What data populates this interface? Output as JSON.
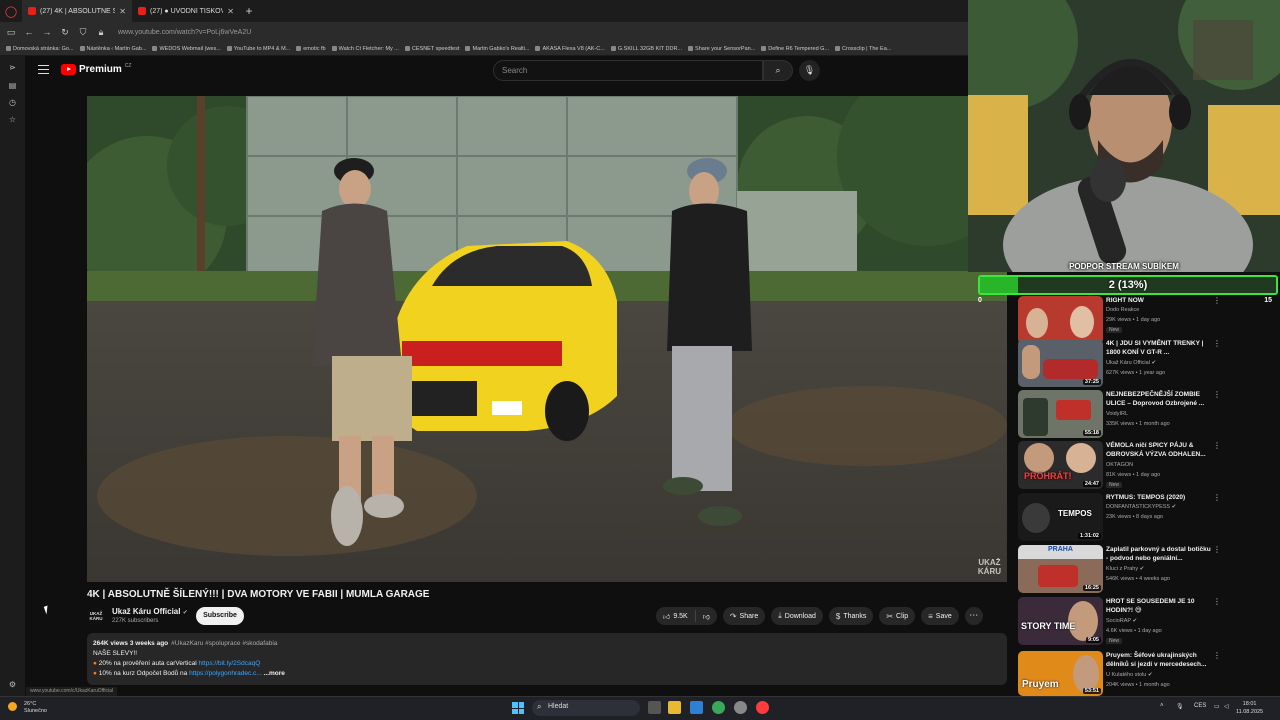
{
  "browser": {
    "tabs": [
      {
        "label": "(27) 4K | ABSOLUTNĚ ŠÍLENÝ!!! | DVA MOTORY",
        "active": true
      },
      {
        "label": "(27) ● ÚVODNÍ TISKOVÁ KONFERENCE",
        "active": false
      }
    ],
    "url": "www.youtube.com/watch?v=PoLj6wVeA2U",
    "bookmarks": [
      "Domovská stránka: Go...",
      "Nástěnka ‹ Martin Gab...",
      "WEDOS Webmail (wes...",
      "YouTube to MP4 & M...",
      "emotic fb",
      "Watch Ct Fletcher: My ...",
      "CESNET speedtest",
      "Martin Gabko's Realti...",
      "AKASA Flexa V8 (AK-C...",
      "G.SKILL 32GB KIT DDR...",
      "Share your SensorPan...",
      "Define R6 Tempered G...",
      "Crossclip | The Ea..."
    ],
    "status_url": "www.youtube.com/c/UkazKaruOfficial"
  },
  "youtube": {
    "logo_word": "Premium",
    "logo_region": "CZ",
    "search_placeholder": "Search"
  },
  "video": {
    "title": "4K | ABSOLUTNĚ ŠÍLENÝ!!! | DVA MOTORY VE FABII | MUMLA GARAGE",
    "watermark_line1": "UKAŽ",
    "watermark_line2": "KÁRU",
    "channel_avatar_text": "UKAŽ KÁRU",
    "channel_name": "Ukaž Káru Official",
    "subscribers": "227K subscribers",
    "subscribe_label": "Subscribe",
    "likes": "9.5K",
    "actions": {
      "share": "Share",
      "download": "Download",
      "thanks": "Thanks",
      "clip": "Clip",
      "save": "Save"
    },
    "description": {
      "meta": "264K views  3 weeks ago",
      "tags": "#UkazKaru #spoluprace #skodafabia",
      "line1": "NAŠE SLEVY!!",
      "line2_text": "20% na prověření auta carVertical ",
      "line2_link": "https://bit.ly/2SdcaqQ",
      "line3_text": "10% na kurz Odpočet Bodů na ",
      "line3_link": "https://polygonhradec.c...",
      "more": "...more"
    }
  },
  "stream": {
    "donation_title": "PODPOR STREAM SUBÍKEM",
    "donation_value": "2 (13%)",
    "donation_fraction": 0.13,
    "donation_min": "0",
    "donation_max": "15"
  },
  "recommendations": [
    {
      "title": "RIGHT NOW",
      "channel": "Dodo Reakce",
      "views": "29K views • 1 day ago",
      "badge": "New",
      "duration": "",
      "thumb_text": ""
    },
    {
      "title": "4K | JDU SI VYMĚNIT TRENKY | 1800 KONÍ V GT-R ...",
      "channel": "Ukaž Káru Official",
      "views": "627K views • 1 year ago",
      "badge": "",
      "duration": "37:25",
      "thumb_text": ""
    },
    {
      "title": "NEJNEBEZPEČNĚJŠÍ ZOMBIE ULICE – Doprovod Ozbrojené ...",
      "channel": "VoidyIRL",
      "views": "335K views • 1 month ago",
      "badge": "",
      "duration": "55:18",
      "thumb_text": ""
    },
    {
      "title": "VÉMOLA ničí SPICY PÁJU & OBROVSKÁ VÝZVA ODHALEN...",
      "channel": "OKTAGON",
      "views": "81K views • 1 day ago",
      "badge": "New",
      "duration": "24:47",
      "thumb_text": "PROHRÁT!"
    },
    {
      "title": "RYTMUS: TEMPOS (2020)",
      "channel": "DONFANTASTICKYPESS",
      "views": "23K views • 8 days ago",
      "badge": "",
      "duration": "1:31:02",
      "thumb_text": "TEMPOS"
    },
    {
      "title": "Zaplatil parkovný a dostal botičku - podvod nebo geniální...",
      "channel": "Kluci z Prahy",
      "views": "546K views • 4 weeks ago",
      "badge": "",
      "duration": "16:25",
      "thumb_text": "PRAHA"
    },
    {
      "title": "HROT SE SOUSEDEMI JE 10 HODIN?! 😅",
      "channel": "SocioRAP",
      "views": "4.6K views • 1 day ago",
      "badge": "New",
      "duration": "9:05",
      "thumb_text": "STORY TIME"
    },
    {
      "title": "Pruyem: Šéfové ukrajinských dělníků si jezdí v mercedesech...",
      "channel": "U Kulatého stolu",
      "views": "204K views • 1 month ago",
      "badge": "",
      "duration": "53:51",
      "thumb_text": "Pruyem"
    }
  ],
  "taskbar": {
    "temperature": "26°C",
    "weather": "Slunečno",
    "search_label": "Hledat",
    "language": "CES",
    "time": "18:01",
    "date": "11.08.2025"
  },
  "colors": {
    "yt_red": "#ff0000",
    "link_blue": "#3ea6ff",
    "donation_green": "#39e639"
  }
}
